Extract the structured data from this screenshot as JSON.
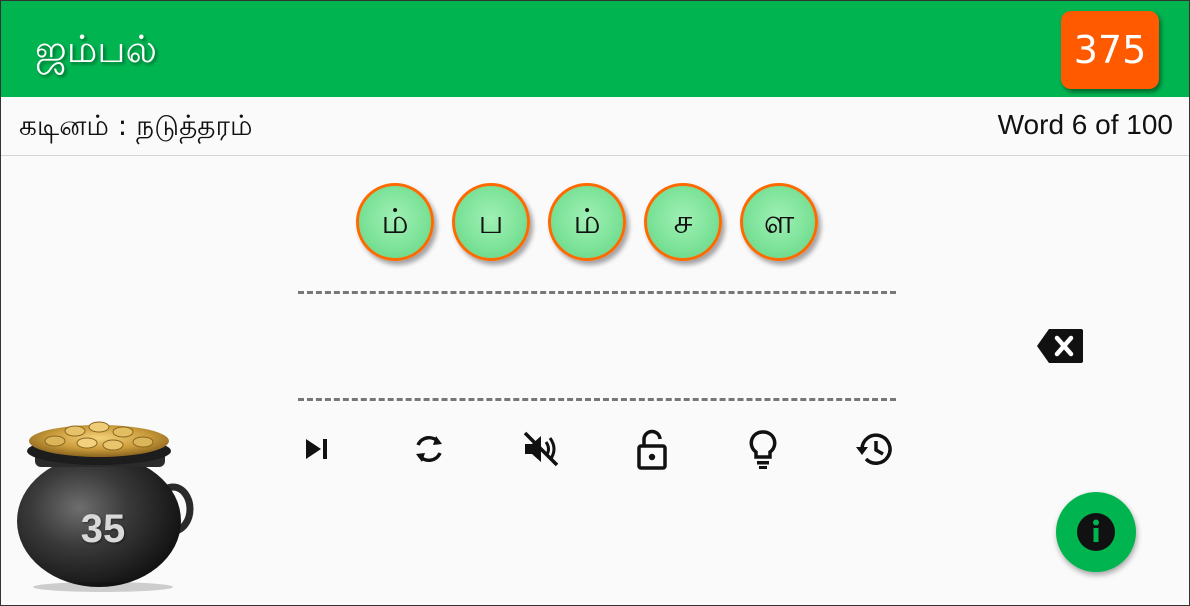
{
  "header": {
    "title": "ஜம்பல்",
    "score": "375",
    "bar_color": "#00b550",
    "score_color": "#ff5a00"
  },
  "info": {
    "difficulty": "கடினம் : நடுத்தரம்",
    "progress": "Word 6 of 100"
  },
  "letters": [
    "ம்",
    "ப",
    "ம்",
    "ச",
    "ள"
  ],
  "answer": {
    "current": ""
  },
  "coins": {
    "count": "35"
  },
  "tools": [
    {
      "name": "skip-next-icon"
    },
    {
      "name": "shuffle-icon"
    },
    {
      "name": "volume-off-icon"
    },
    {
      "name": "unlock-icon"
    },
    {
      "name": "lightbulb-hint-icon"
    },
    {
      "name": "history-icon"
    }
  ],
  "icons": {
    "backspace": "backspace-icon",
    "fab": "info-icon"
  }
}
